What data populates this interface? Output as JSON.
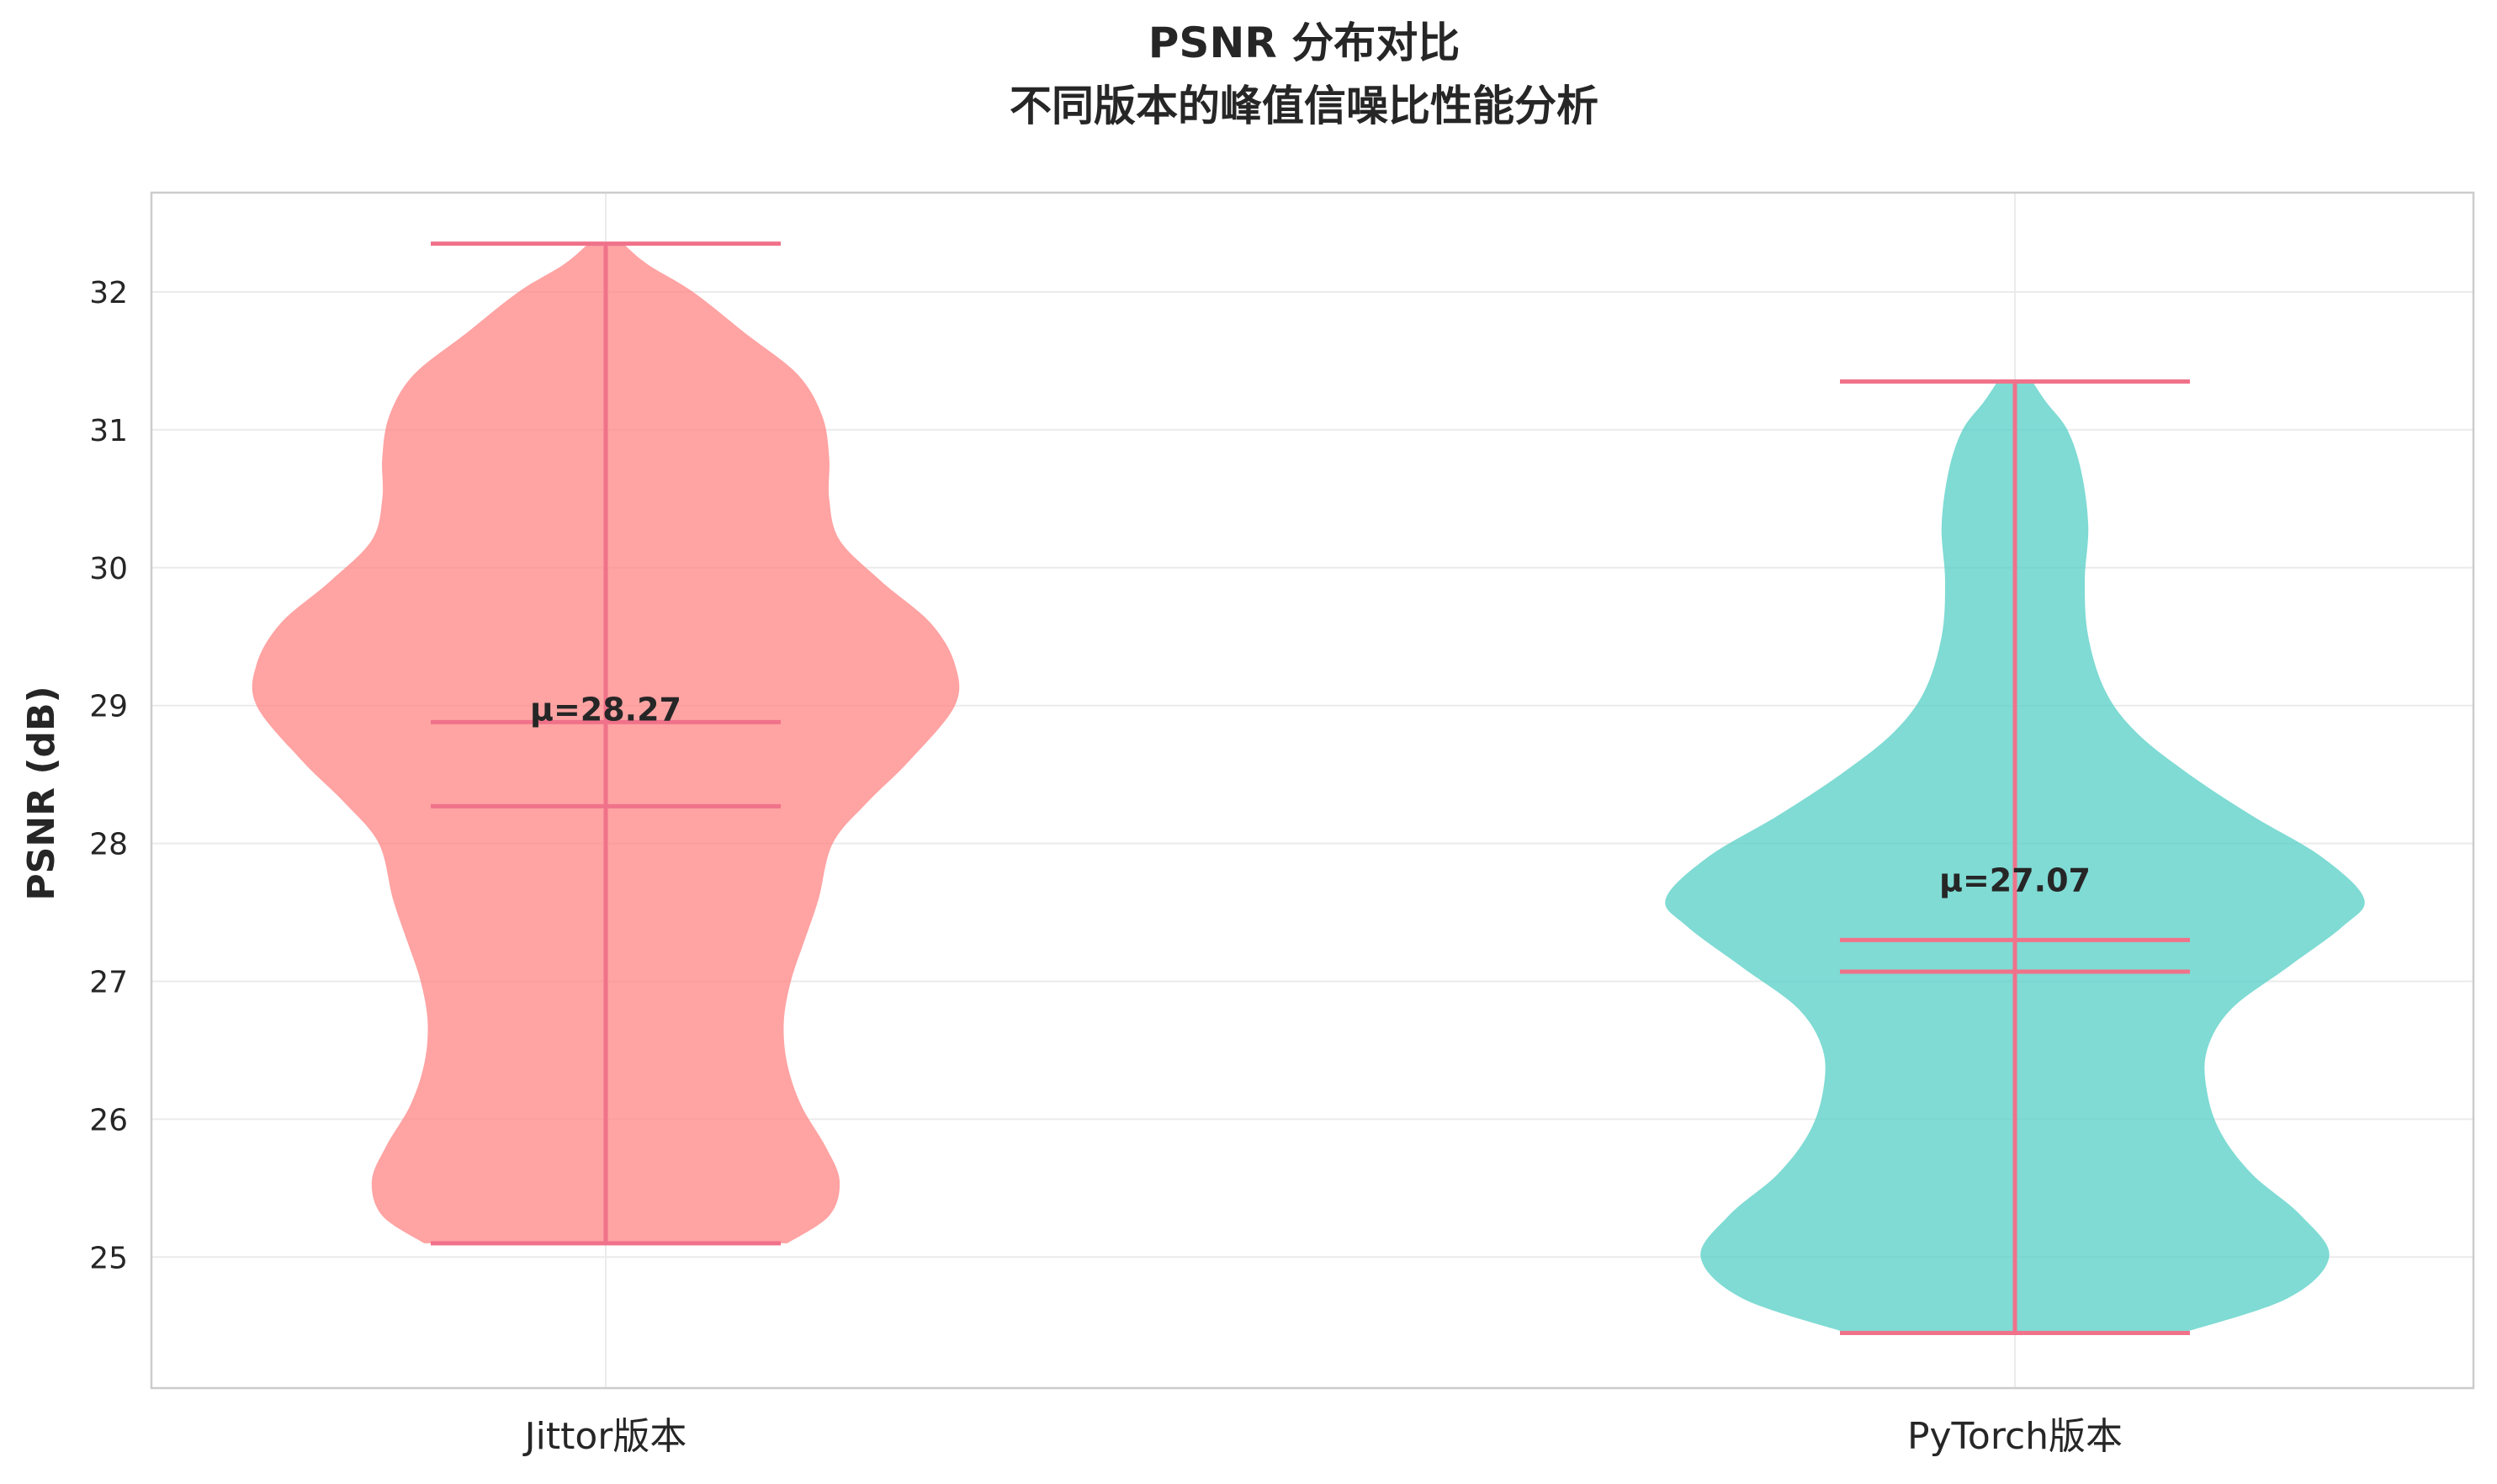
{
  "chart_data": {
    "type": "violin",
    "title": "PSNR 分布对比",
    "subtitle": "不同版本的峰值信噪比性能分析",
    "xlabel": "",
    "ylabel": "PSNR (dB)",
    "ylim": [
      24.05,
      32.72
    ],
    "yticks": [
      25,
      26,
      27,
      28,
      29,
      30,
      31,
      32
    ],
    "grid": true,
    "categories": [
      "Jittor版本",
      "PyTorch版本"
    ],
    "series": [
      {
        "category": "Jittor版本",
        "color": "#FF7F7F",
        "min": 25.1,
        "max": 32.35,
        "mean": 28.27,
        "median": 28.88,
        "mean_label": "μ=28.27",
        "density": [
          [
            25.1,
            0.52
          ],
          [
            25.3,
            0.64
          ],
          [
            25.55,
            0.67
          ],
          [
            25.8,
            0.63
          ],
          [
            26.1,
            0.56
          ],
          [
            26.4,
            0.52
          ],
          [
            26.7,
            0.51
          ],
          [
            27.0,
            0.53
          ],
          [
            27.3,
            0.57
          ],
          [
            27.6,
            0.61
          ],
          [
            28.0,
            0.65
          ],
          [
            28.3,
            0.75
          ],
          [
            28.6,
            0.87
          ],
          [
            29.0,
            1.0
          ],
          [
            29.3,
            1.0
          ],
          [
            29.6,
            0.93
          ],
          [
            29.9,
            0.79
          ],
          [
            30.2,
            0.67
          ],
          [
            30.5,
            0.64
          ],
          [
            30.8,
            0.64
          ],
          [
            31.1,
            0.62
          ],
          [
            31.4,
            0.55
          ],
          [
            31.7,
            0.4
          ],
          [
            32.0,
            0.25
          ],
          [
            32.2,
            0.12
          ],
          [
            32.35,
            0.05
          ]
        ]
      },
      {
        "category": "PyTorch版本",
        "color": "#4ECDC4",
        "min": 24.45,
        "max": 31.35,
        "mean": 27.07,
        "median": 27.3,
        "mean_label": "μ=27.07",
        "density": [
          [
            24.45,
            0.48
          ],
          [
            24.7,
            0.78
          ],
          [
            25.0,
            0.9
          ],
          [
            25.3,
            0.82
          ],
          [
            25.6,
            0.68
          ],
          [
            25.9,
            0.59
          ],
          [
            26.2,
            0.55
          ],
          [
            26.5,
            0.55
          ],
          [
            26.8,
            0.62
          ],
          [
            27.1,
            0.78
          ],
          [
            27.4,
            0.94
          ],
          [
            27.6,
            1.0
          ],
          [
            27.9,
            0.88
          ],
          [
            28.2,
            0.68
          ],
          [
            28.5,
            0.5
          ],
          [
            28.8,
            0.35
          ],
          [
            29.1,
            0.26
          ],
          [
            29.5,
            0.21
          ],
          [
            29.9,
            0.2
          ],
          [
            30.3,
            0.21
          ],
          [
            30.7,
            0.19
          ],
          [
            31.0,
            0.15
          ],
          [
            31.2,
            0.09
          ],
          [
            31.35,
            0.05
          ]
        ]
      }
    ],
    "line_color": "#F0728A"
  }
}
